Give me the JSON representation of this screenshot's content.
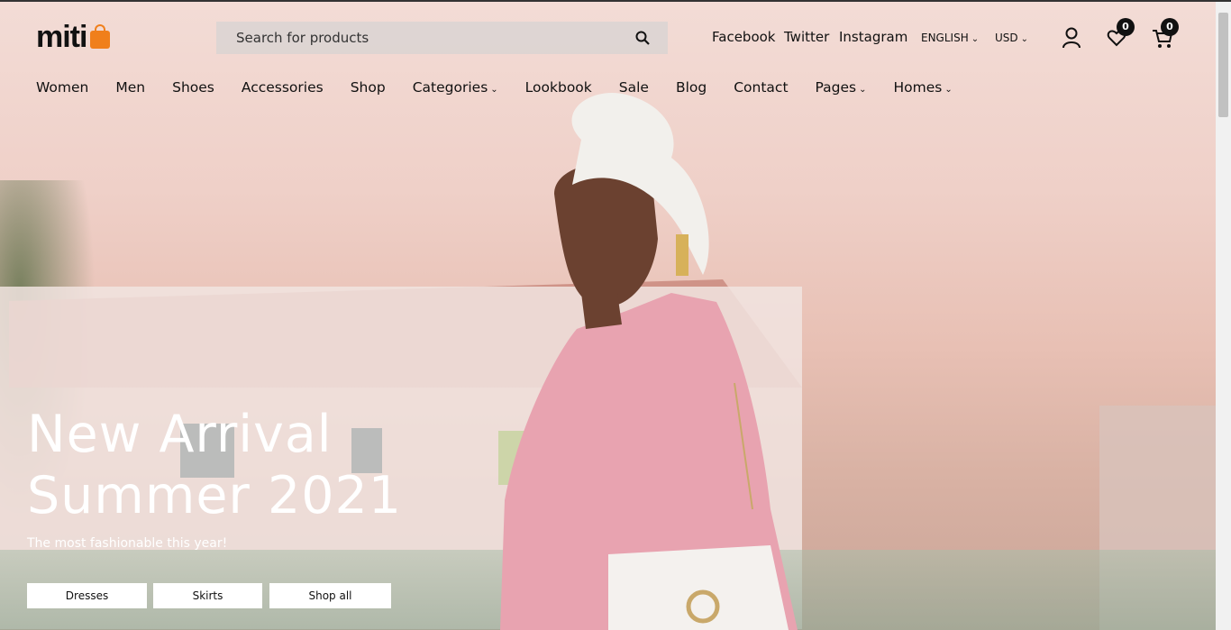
{
  "brand": {
    "name": "miti"
  },
  "search": {
    "placeholder": "Search for products"
  },
  "social_links": [
    "Facebook",
    "Twitter",
    "Instagram"
  ],
  "selectors": {
    "language": "ENGLISH",
    "currency": "USD"
  },
  "counts": {
    "wishlist": "0",
    "cart": "0"
  },
  "nav": [
    "Women",
    "Men",
    "Shoes",
    "Accessories",
    "Shop",
    "Categories",
    "Lookbook",
    "Sale",
    "Blog",
    "Contact",
    "Pages",
    "Homes"
  ],
  "hero": {
    "title_line1": "New Arrival",
    "title_line2": "Summer 2021",
    "subtitle": "The most fashionable this year!",
    "buttons": [
      "Dresses",
      "Skirts",
      "Shop all"
    ]
  },
  "colors": {
    "accent": "#f07f1b",
    "text": "#111111"
  }
}
